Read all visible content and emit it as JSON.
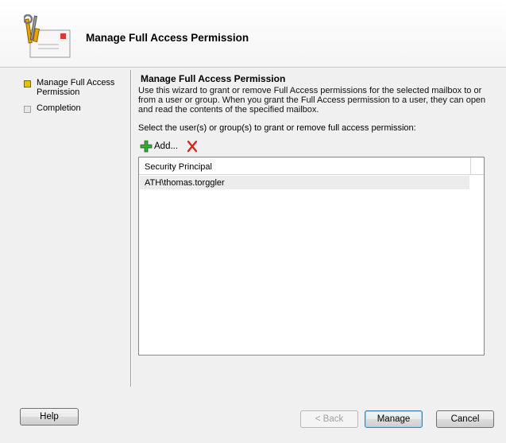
{
  "header": {
    "title": "Manage Full Access Permission",
    "icon": "wizard-envelope-tools-icon"
  },
  "steps": [
    {
      "label": "Manage Full Access Permission",
      "state": "active"
    },
    {
      "label": "Completion",
      "state": "inactive"
    }
  ],
  "content": {
    "title": "Manage Full Access Permission",
    "description": "Use this wizard to grant or remove Full Access permissions for the selected mailbox to or from a user or group. When you grant the Full Access permission to a user, they can open and read the contents of the specified mailbox.",
    "select_label": "Select the user(s) or group(s) to grant or remove full access permission:"
  },
  "toolbar": {
    "add_label": "Add...",
    "add_icon": "green-plus-icon",
    "remove_icon": "red-x-icon"
  },
  "list": {
    "column_header": "Security Principal",
    "rows": [
      {
        "principal": "ATH\\thomas.torggler"
      }
    ]
  },
  "buttons": {
    "help": "Help",
    "back": "< Back",
    "manage": "Manage",
    "cancel": "Cancel"
  },
  "colors": {
    "active_step": "#e3c200",
    "add_green": "#3aa53a",
    "remove_red": "#d42a1c"
  }
}
